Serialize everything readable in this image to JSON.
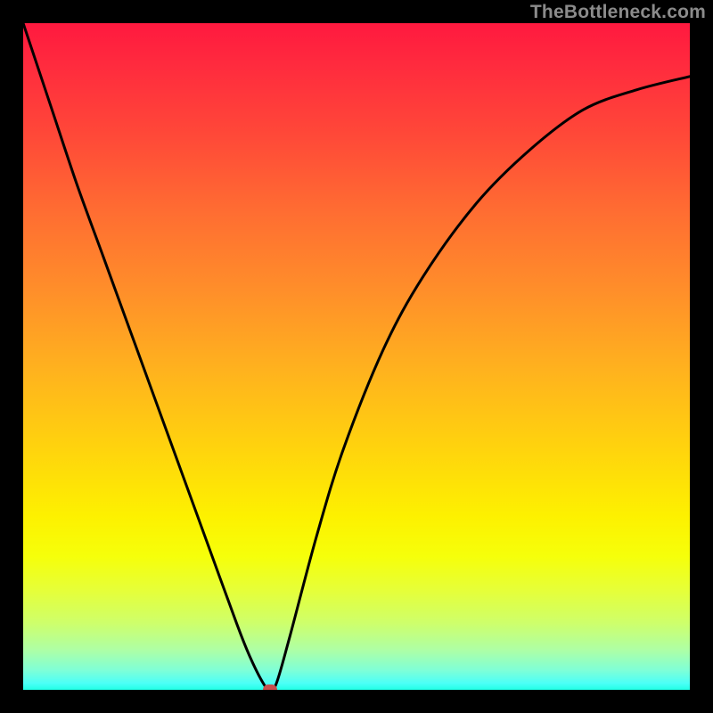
{
  "watermark": "TheBottleneck.com",
  "chart_data": {
    "type": "line",
    "title": "",
    "xlabel": "",
    "ylabel": "",
    "xlim": [
      0,
      100
    ],
    "ylim": [
      0,
      100
    ],
    "grid": false,
    "series": [
      {
        "name": "bottleneck-curve",
        "x": [
          0,
          4,
          8,
          12,
          16,
          20,
          24,
          28,
          32,
          34,
          36,
          37,
          38,
          40,
          44,
          48,
          54,
          60,
          68,
          76,
          84,
          92,
          100
        ],
        "y": [
          100,
          88,
          76,
          65,
          54,
          43,
          32,
          21,
          10,
          5,
          1,
          0,
          1,
          8,
          23,
          36,
          51,
          62,
          73,
          81,
          87,
          90,
          92
        ]
      }
    ],
    "marker": {
      "x": 37,
      "y": 0,
      "color": "#c94f4f"
    },
    "gradient_description": "vertical pink-red to orange to yellow to green/cyan",
    "frame_color": "#000000"
  },
  "layout": {
    "image_size": 800,
    "frame_inset": 26,
    "plot_size": 748
  },
  "colors": {
    "marker": "#c94f4f",
    "curve": "#000000",
    "watermark": "#8b8b8b"
  }
}
